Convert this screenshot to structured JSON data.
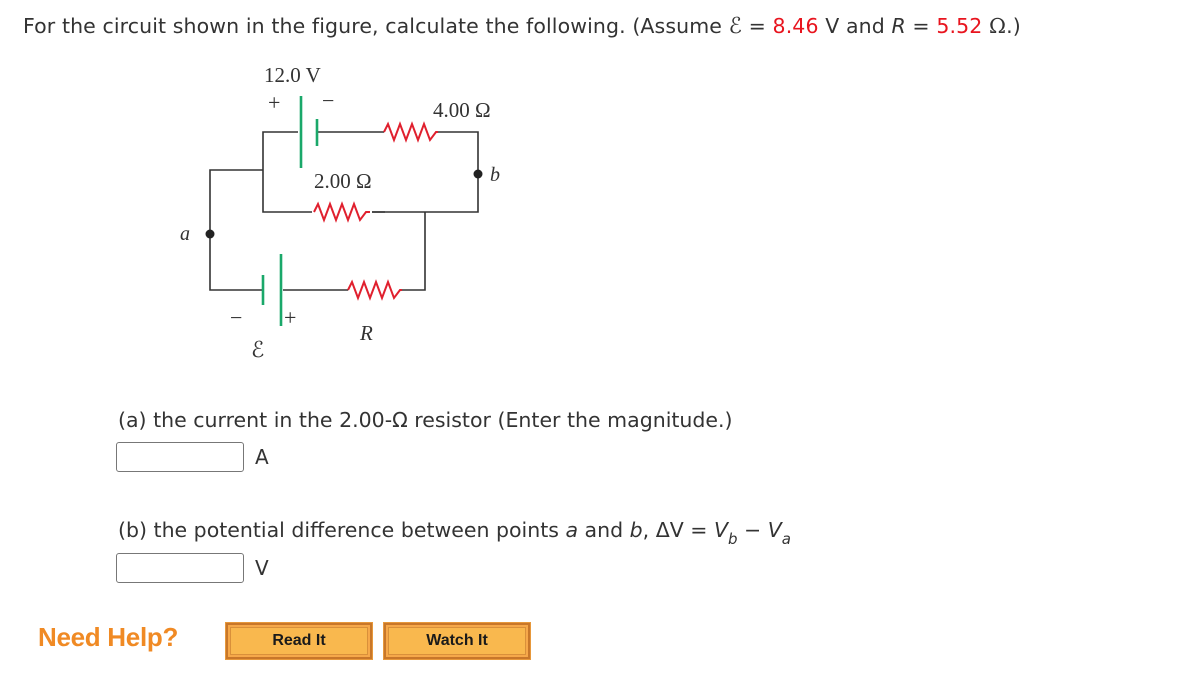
{
  "prompt": {
    "text_before": "For the circuit shown in the figure, calculate the following. (Assume ",
    "emf_symbol": "ℰ",
    "eq1": " = ",
    "emf_value": "8.46",
    "emf_unit_and": " V and ",
    "r_symbol": "R",
    "eq2": " = ",
    "r_value": "5.52",
    "r_unit": " Ω",
    "close": ".)"
  },
  "circuit": {
    "battery_top_label": "12.0 V",
    "battery_top_plus": "+",
    "battery_top_minus": "−",
    "resistor_top_label": "4.00 Ω",
    "resistor_mid_label": "2.00 Ω",
    "resistor_bottom_label": "R",
    "battery_bottom_minus": "−",
    "battery_bottom_plus": "+",
    "battery_bottom_label": "ℰ",
    "point_a": "a",
    "point_b": "b",
    "colors": {
      "wire": "#333333",
      "battery": "#1aa86a",
      "resistor": "#e0202e"
    }
  },
  "questions": {
    "a": {
      "label": "(a) the current in the 2.00-Ω resistor (Enter the magnitude.)",
      "value": "",
      "unit": "A"
    },
    "b": {
      "label_before": "(b) the potential difference between points ",
      "a_var": "a",
      "and": " and ",
      "b_var": "b",
      "comma": ", ΔV = ",
      "v1": "V",
      "sub1": "b",
      "minus": " − ",
      "v2": "V",
      "sub2": "a",
      "value": "",
      "unit": "V"
    }
  },
  "help": {
    "label": "Need Help?",
    "read_button": "Read It",
    "watch_button": "Watch It"
  }
}
